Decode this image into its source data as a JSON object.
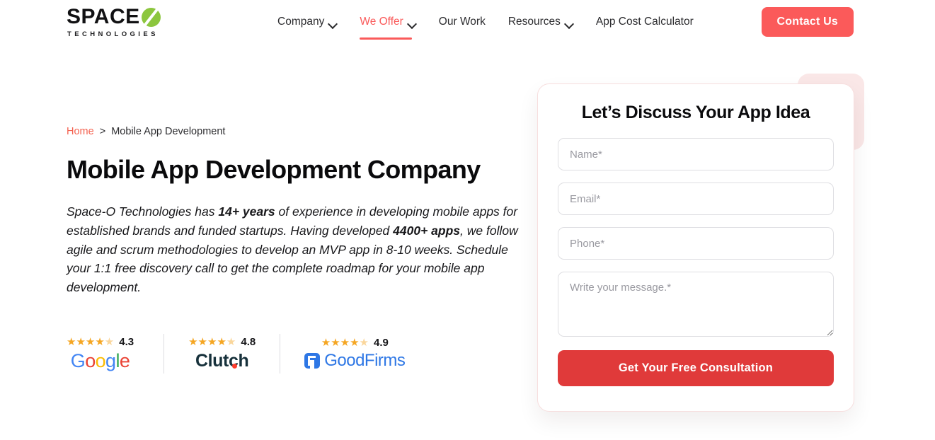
{
  "header": {
    "logo": {
      "word": "SPACE",
      "mark": "o-slash-mark",
      "tagline": "TECHNOLOGIES"
    },
    "nav": [
      {
        "label": "Company",
        "has_dropdown": true,
        "active": false
      },
      {
        "label": "We Offer",
        "has_dropdown": true,
        "active": true
      },
      {
        "label": "Our Work",
        "has_dropdown": false,
        "active": false
      },
      {
        "label": "Resources",
        "has_dropdown": true,
        "active": false
      },
      {
        "label": "App Cost Calculator",
        "has_dropdown": false,
        "active": false
      }
    ],
    "cta_label": "Contact Us"
  },
  "hero": {
    "breadcrumb": {
      "home": "Home",
      "separator": ">",
      "current": "Mobile App Development"
    },
    "title": "Mobile App Development Company",
    "intro": {
      "part1": "Space-O Technologies has ",
      "bold1": "14+ years",
      "part2": " of experience in developing mobile apps for established brands and funded startups. Having developed ",
      "bold2": "4400+ apps",
      "part3": ", we follow agile and scrum methodologies to develop an MVP app in 8-10 weeks. Schedule your 1:1 free discovery call to get the complete roadmap for your mobile app development."
    }
  },
  "ratings": [
    {
      "name": "Google",
      "score": "4.3",
      "stars": "★★★★",
      "half_star": "★"
    },
    {
      "name": "Clutch",
      "score": "4.8",
      "stars": "★★★★",
      "half_star": "★"
    },
    {
      "name": "GoodFirms",
      "score": "4.9",
      "stars": "★★★★",
      "half_star": "★"
    }
  ],
  "form": {
    "title": "Let’s Discuss Your App Idea",
    "name_placeholder": "Name*",
    "email_placeholder": "Email*",
    "phone_placeholder": "Phone*",
    "message_placeholder": "Write your message.*",
    "name_value": "",
    "email_value": "",
    "phone_value": "",
    "message_value": "",
    "submit_label": "Get Your Free Consultation"
  },
  "colors": {
    "accent_coral": "#fb5a5a",
    "accent_red": "#e03a3a",
    "logo_green": "#8cc63e",
    "pink_block": "#fae7e7",
    "breadcrumb_link": "#f4614f",
    "star_gold": "#f5a623"
  }
}
